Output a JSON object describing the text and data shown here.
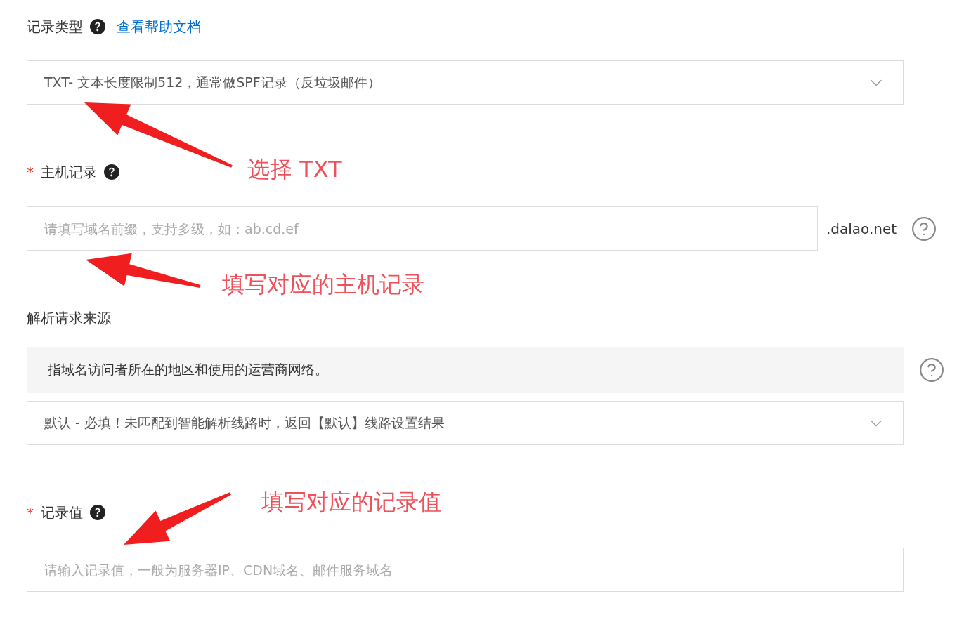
{
  "record_type": {
    "label": "记录类型",
    "help_link": "查看帮助文档",
    "value": "TXT- 文本长度限制512，通常做SPF记录（反垃圾邮件）"
  },
  "host": {
    "required_mark": "*",
    "label": "主机记录",
    "placeholder": "请填写域名前缀，支持多级，如：ab.cd.ef",
    "suffix": ".dalao.net"
  },
  "source": {
    "label": "解析请求来源",
    "hint": "指域名访问者所在的地区和使用的运营商网络。",
    "value": "默认 - 必填！未匹配到智能解析线路时，返回【默认】线路设置结果"
  },
  "record_value": {
    "required_mark": "*",
    "label": "记录值",
    "placeholder": "请输入记录值，一般为服务器IP、CDN域名、邮件服务域名"
  },
  "annotations": [
    {
      "text": "选择 TXT"
    },
    {
      "text": "填写对应的主机记录"
    },
    {
      "text": "填写对应的记录值"
    }
  ]
}
